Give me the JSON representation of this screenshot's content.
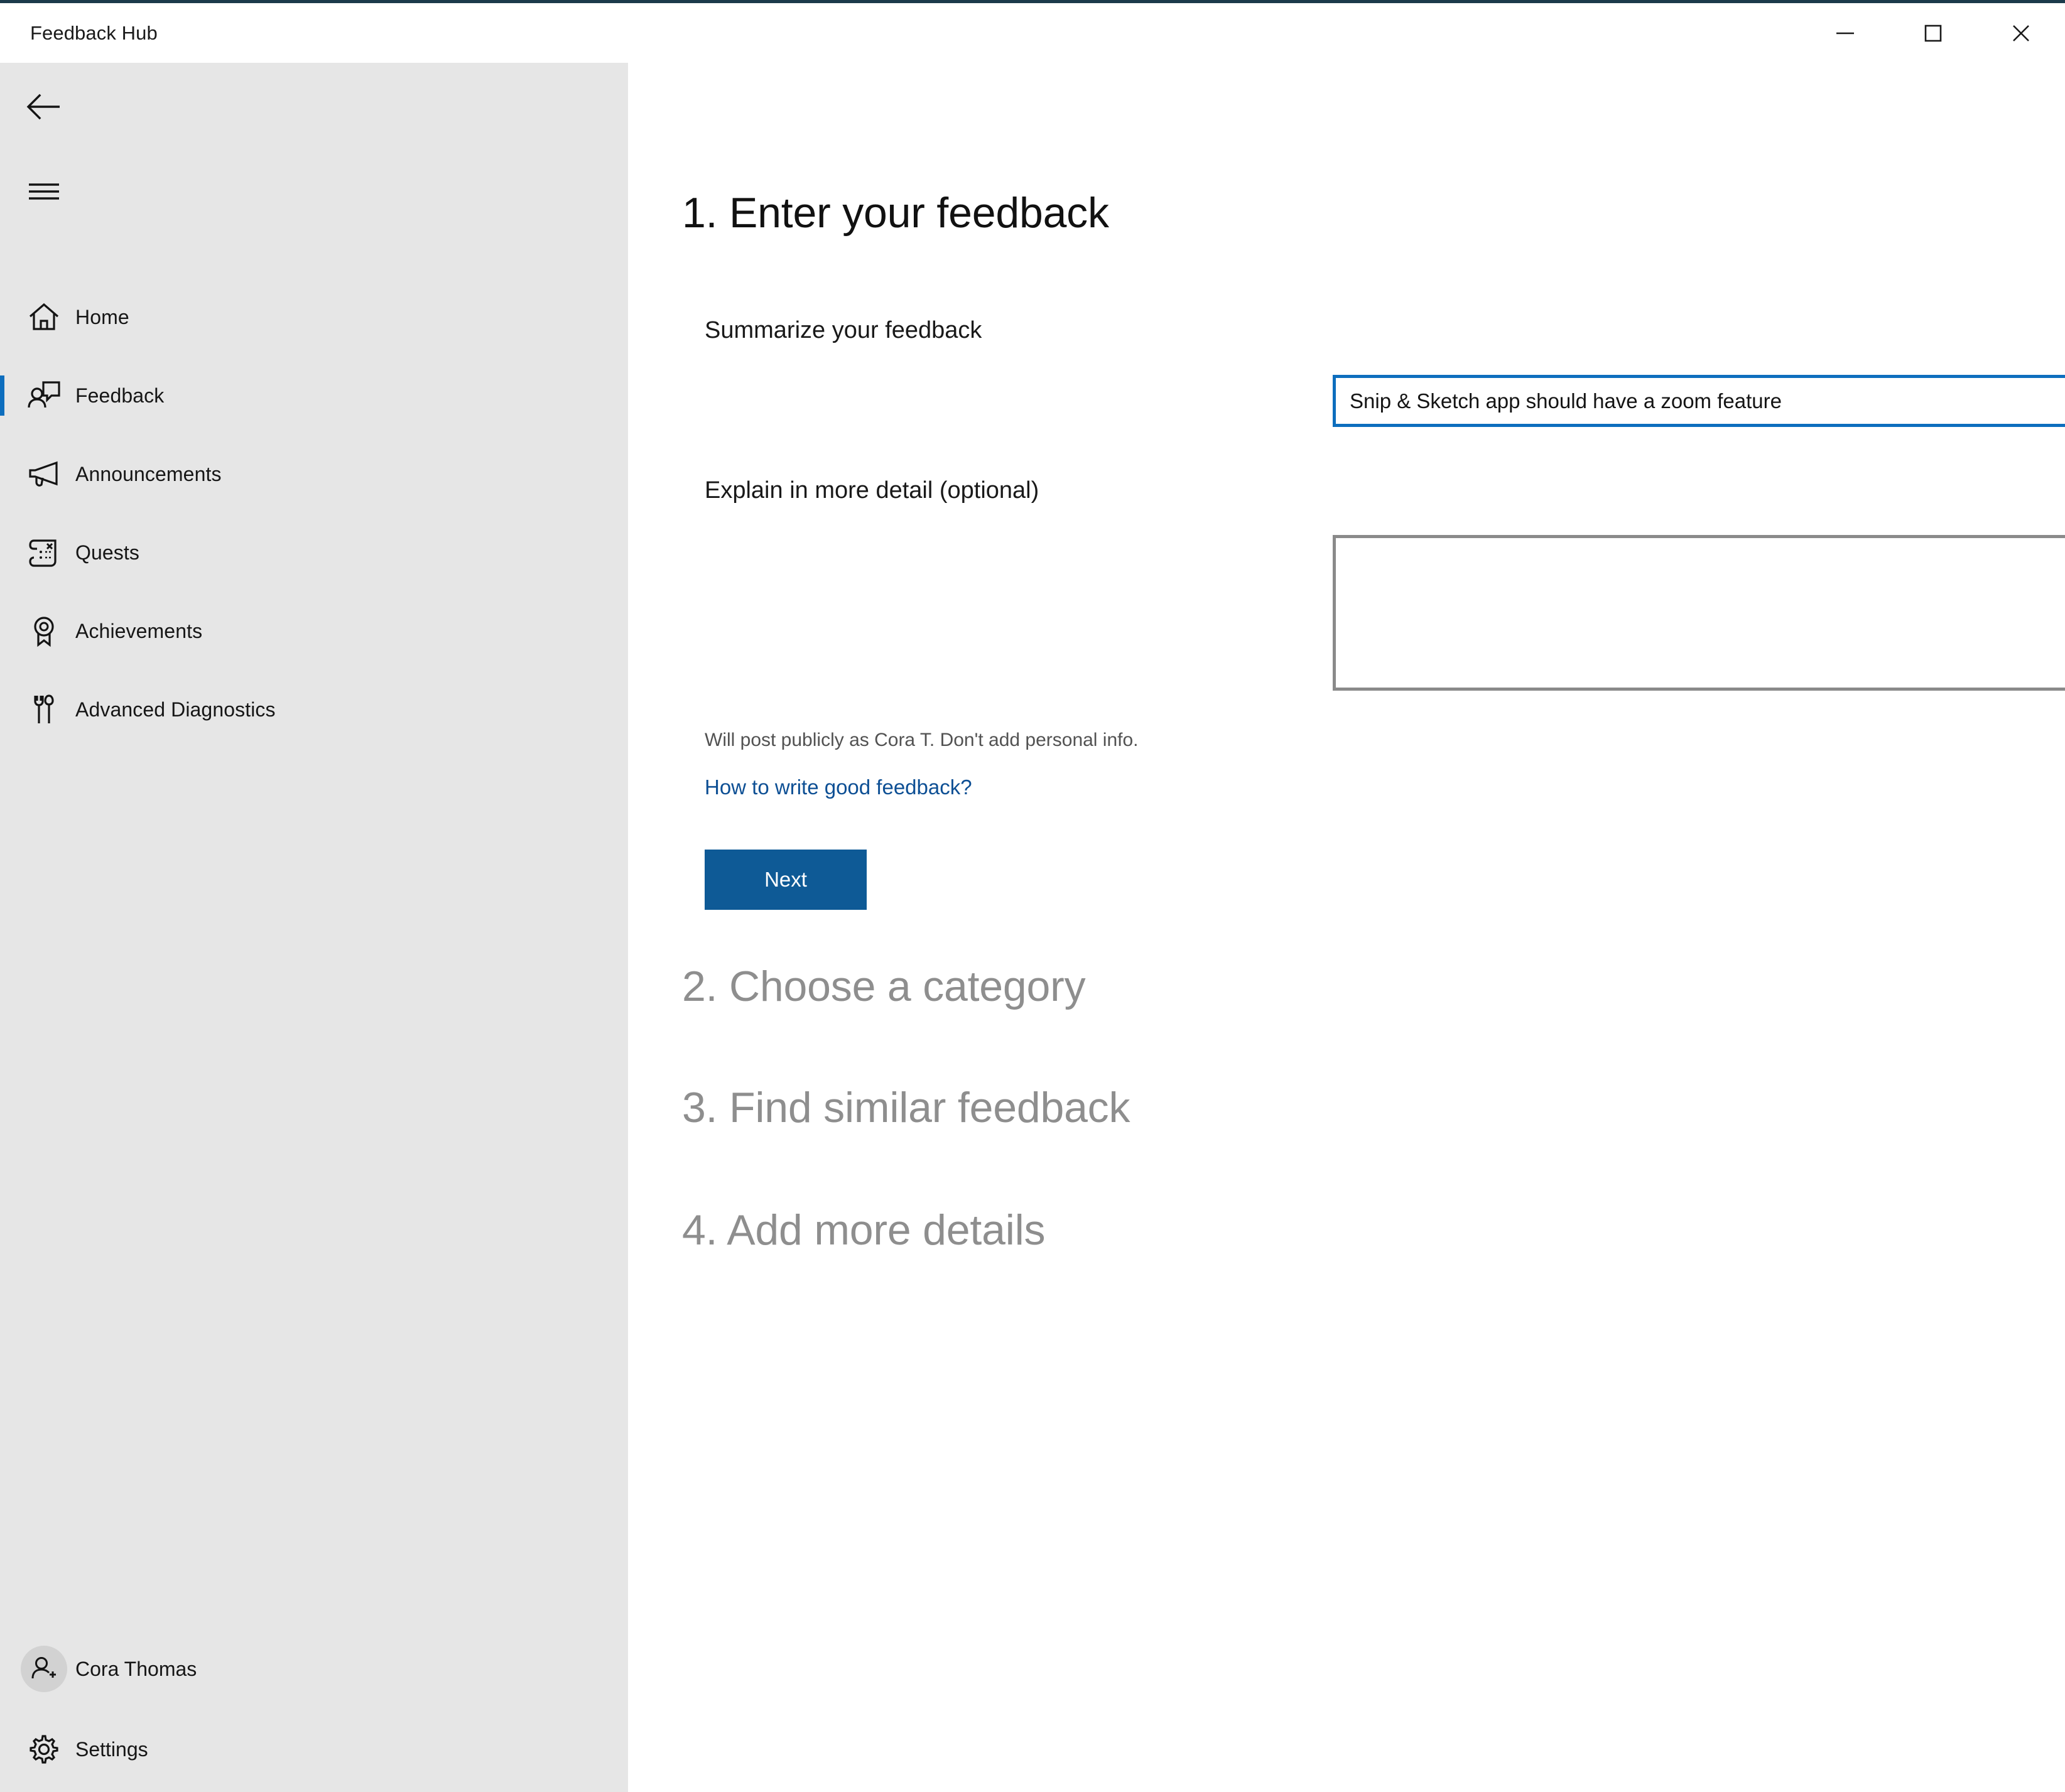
{
  "window": {
    "title": "Feedback Hub",
    "controls": [
      {
        "name": "minimize",
        "glyph": "minimize-icon"
      },
      {
        "name": "maximize",
        "glyph": "maximize-icon"
      },
      {
        "name": "close",
        "glyph": "close-icon"
      }
    ]
  },
  "sidebar": {
    "back_label": "Back",
    "menu_label": "Navigation menu",
    "items": [
      {
        "label": "Home",
        "icon": "home-icon",
        "selected": false
      },
      {
        "label": "Feedback",
        "icon": "feedback-icon",
        "selected": true
      },
      {
        "label": "Announcements",
        "icon": "megaphone-icon",
        "selected": false
      },
      {
        "label": "Quests",
        "icon": "scroll-icon",
        "selected": false
      },
      {
        "label": "Achievements",
        "icon": "medal-icon",
        "selected": false
      },
      {
        "label": "Advanced Diagnostics",
        "icon": "tools-icon",
        "selected": false
      }
    ],
    "account": {
      "label": "Cora Thomas",
      "icon": "account-add-icon"
    },
    "settings": {
      "label": "Settings",
      "icon": "gear-icon"
    }
  },
  "main": {
    "steps": [
      {
        "number": "1.",
        "title": "1. Enter your feedback",
        "state": "active"
      },
      {
        "number": "2.",
        "title": "2. Choose a category",
        "state": "inactive"
      },
      {
        "number": "3.",
        "title": "3. Find similar feedback",
        "state": "inactive"
      },
      {
        "number": "4.",
        "title": "4. Add more details",
        "state": "inactive"
      }
    ],
    "summary": {
      "label": "Summarize your feedback",
      "value": "Snip & Sketch app should have a zoom feature",
      "placeholder": ""
    },
    "detail": {
      "label": "Explain in more detail (optional)",
      "value": "",
      "placeholder": ""
    },
    "privacy_note": "Will post publicly as Cora T. Don't add personal info.",
    "help_link": "How to write good feedback?",
    "next_button": "Next"
  },
  "colors": {
    "accent_blue": "#0d6ebe",
    "button_blue": "#0e5a96",
    "link_blue": "#0d4f94",
    "sidebar_bg": "#e6e6e6",
    "inactive_gray": "#8e8e8e",
    "titlebar_border": "#1b3a4b"
  }
}
